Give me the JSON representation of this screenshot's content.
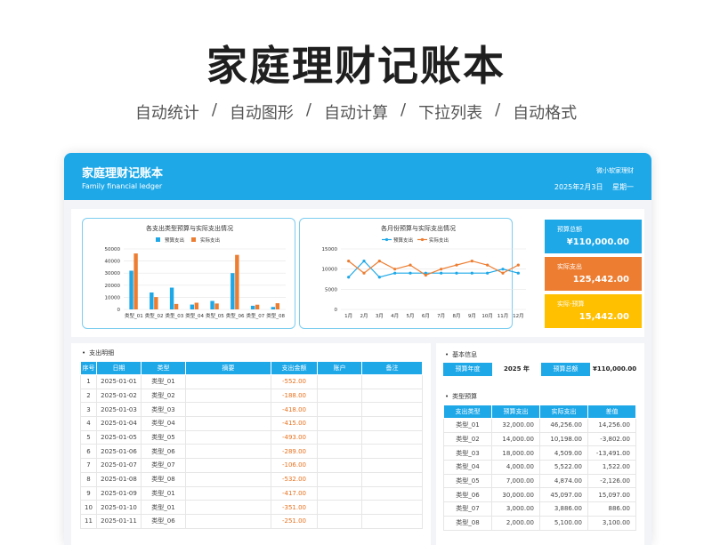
{
  "hero": {
    "title": "家庭理财记账本",
    "features": [
      "自动统计",
      "自动图形",
      "自动计算",
      "下拉列表",
      "自动格式"
    ],
    "separator": "/"
  },
  "header": {
    "title": "家庭理财记账本",
    "subtitle": "Family financial ledger",
    "brand": "微小软家理财",
    "date": "2025年2月3日",
    "weekday": "星期一"
  },
  "colors": {
    "accent": "#1ea8e8",
    "orange": "#ed7d31",
    "yellow": "#ffc000",
    "negative": "#e8711d"
  },
  "stats": [
    {
      "label": "预算总额",
      "value": "¥110,000.00",
      "color": "#1ea8e8"
    },
    {
      "label": "实际支出",
      "value": "125,442.00",
      "color": "#ed7d31"
    },
    {
      "label": "实际-预算",
      "value": "15,442.00",
      "color": "#ffc000"
    }
  ],
  "expense_section": {
    "title": "支出明细",
    "columns": [
      "序号",
      "日期",
      "类型",
      "摘要",
      "支出金额",
      "账户",
      "备注"
    ],
    "rows": [
      [
        "1",
        "2025-01-01",
        "类型_01",
        "",
        "-552.00",
        "",
        ""
      ],
      [
        "2",
        "2025-01-02",
        "类型_02",
        "",
        "-188.00",
        "",
        ""
      ],
      [
        "3",
        "2025-01-03",
        "类型_03",
        "",
        "-418.00",
        "",
        ""
      ],
      [
        "4",
        "2025-01-04",
        "类型_04",
        "",
        "-415.00",
        "",
        ""
      ],
      [
        "5",
        "2025-01-05",
        "类型_05",
        "",
        "-493.00",
        "",
        ""
      ],
      [
        "6",
        "2025-01-06",
        "类型_06",
        "",
        "-289.00",
        "",
        ""
      ],
      [
        "7",
        "2025-01-07",
        "类型_07",
        "",
        "-106.00",
        "",
        ""
      ],
      [
        "8",
        "2025-01-08",
        "类型_08",
        "",
        "-532.00",
        "",
        ""
      ],
      [
        "9",
        "2025-01-09",
        "类型_01",
        "",
        "-417.00",
        "",
        ""
      ],
      [
        "10",
        "2025-01-10",
        "类型_01",
        "",
        "-351.00",
        "",
        ""
      ],
      [
        "11",
        "2025-01-11",
        "类型_06",
        "",
        "-251.00",
        "",
        ""
      ]
    ]
  },
  "basic_info": {
    "title": "基本信息",
    "year_label": "预算年度",
    "year_value": "2025 年",
    "total_label": "预算总额",
    "total_value": "¥110,000.00"
  },
  "type_budget": {
    "title": "类型预算",
    "columns": [
      "支出类型",
      "预算支出",
      "实际支出",
      "差值"
    ],
    "rows": [
      [
        "类型_01",
        "32,000.00",
        "46,256.00",
        "14,256.00"
      ],
      [
        "类型_02",
        "14,000.00",
        "10,198.00",
        "-3,802.00"
      ],
      [
        "类型_03",
        "18,000.00",
        "4,509.00",
        "-13,491.00"
      ],
      [
        "类型_04",
        "4,000.00",
        "5,522.00",
        "1,522.00"
      ],
      [
        "类型_05",
        "7,000.00",
        "4,874.00",
        "-2,126.00"
      ],
      [
        "类型_06",
        "30,000.00",
        "45,097.00",
        "15,097.00"
      ],
      [
        "类型_07",
        "3,000.00",
        "3,886.00",
        "886.00"
      ],
      [
        "类型_08",
        "2,000.00",
        "5,100.00",
        "3,100.00"
      ]
    ]
  },
  "chart_data": [
    {
      "type": "bar",
      "title": "各支出类型预算与实际支出情况",
      "categories": [
        "类型_01",
        "类型_02",
        "类型_03",
        "类型_04",
        "类型_05",
        "类型_06",
        "类型_07",
        "类型_08"
      ],
      "series": [
        {
          "name": "预算支出",
          "values": [
            32000,
            14000,
            18000,
            4000,
            7000,
            30000,
            3000,
            2000
          ],
          "color": "#1ea8e8"
        },
        {
          "name": "实际支出",
          "values": [
            46256,
            10198,
            4509,
            5522,
            4874,
            45097,
            3886,
            5100
          ],
          "color": "#ed7d31"
        }
      ],
      "yticks": [
        "0",
        "10000",
        "20000",
        "30000",
        "40000",
        "50000"
      ],
      "ylim": [
        0,
        50000
      ],
      "legend": "top"
    },
    {
      "type": "line",
      "title": "各月份预算与实际支出情况",
      "categories": [
        "1月",
        "2月",
        "3月",
        "4月",
        "5月",
        "6月",
        "7月",
        "8月",
        "9月",
        "10月",
        "11月",
        "12月"
      ],
      "series": [
        {
          "name": "预算支出",
          "values": [
            8000,
            12000,
            8000,
            9000,
            9000,
            9000,
            9000,
            9000,
            9000,
            9000,
            10000,
            9000
          ],
          "color": "#1ea8e8"
        },
        {
          "name": "实际支出",
          "values": [
            12000,
            9000,
            12000,
            10000,
            11000,
            8500,
            10000,
            11000,
            12000,
            11000,
            9000,
            11000
          ],
          "color": "#ed7d31"
        }
      ],
      "yticks": [
        "0",
        "5000",
        "10000",
        "15000"
      ],
      "ylim": [
        0,
        15000
      ],
      "legend": "top"
    }
  ]
}
